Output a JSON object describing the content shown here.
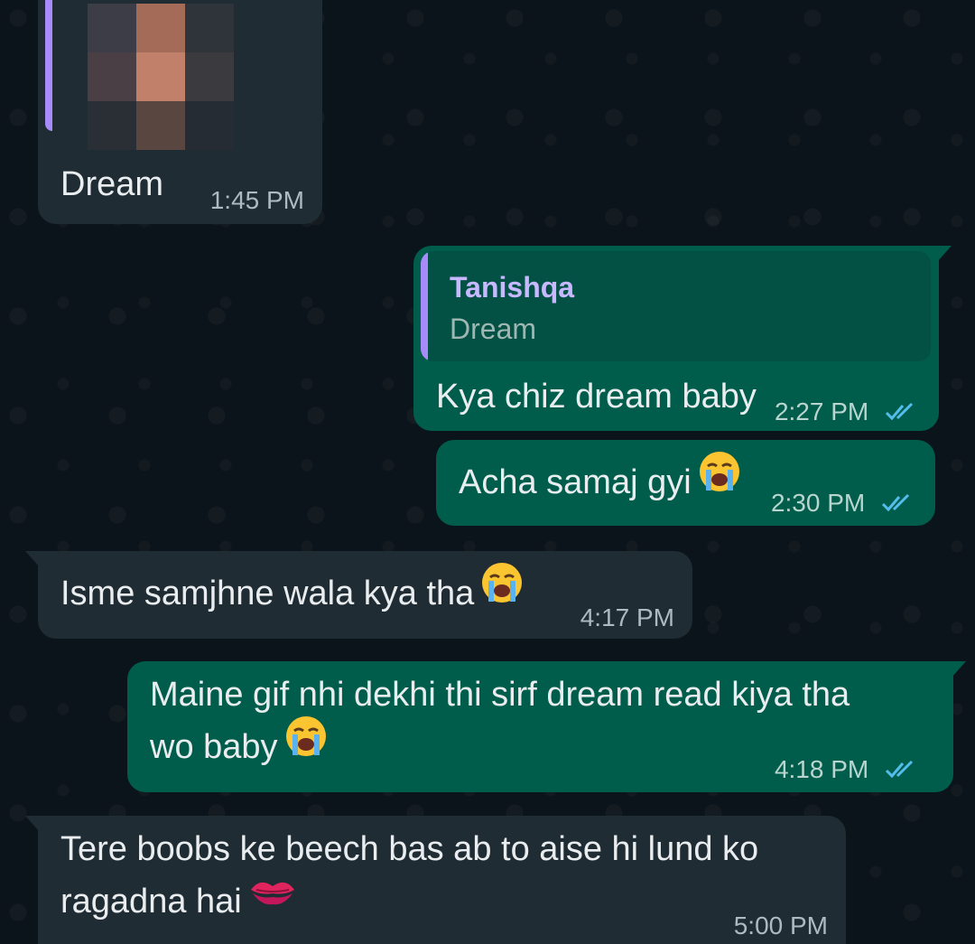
{
  "colors": {
    "chat_background": "#0b141a",
    "incoming_bubble": "#202c33",
    "outgoing_bubble": "#005c4b",
    "reply_accent": "#a78bfa",
    "read_ticks": "#53bdeb"
  },
  "messages": [
    {
      "direction": "incoming",
      "has_blurred_image": true,
      "text": "Dream",
      "time": "1:45 PM"
    },
    {
      "direction": "outgoing",
      "reply": {
        "sender": "Tanishqa",
        "text": "Dream"
      },
      "text": "Kya chiz dream baby",
      "time": "2:27 PM",
      "status": "read"
    },
    {
      "direction": "outgoing",
      "text": "Acha samaj gyi",
      "emoji": "loudly-crying-face",
      "time": "2:30 PM",
      "status": "read"
    },
    {
      "direction": "incoming",
      "text": "Isme samjhne wala kya tha",
      "emoji": "loudly-crying-face",
      "time": "4:17 PM"
    },
    {
      "direction": "outgoing",
      "text_line1": "Maine gif nhi dekhi thi sirf dream read kiya tha",
      "text_line2": "wo baby",
      "emoji": "loudly-crying-face",
      "time": "4:18 PM",
      "status": "read"
    },
    {
      "direction": "incoming",
      "text_line1": "Tere boobs ke beech bas ab to aise hi lund ko",
      "text_line2": "ragadna hai",
      "emoji": "kiss-mark",
      "time": "5:00 PM"
    }
  ]
}
